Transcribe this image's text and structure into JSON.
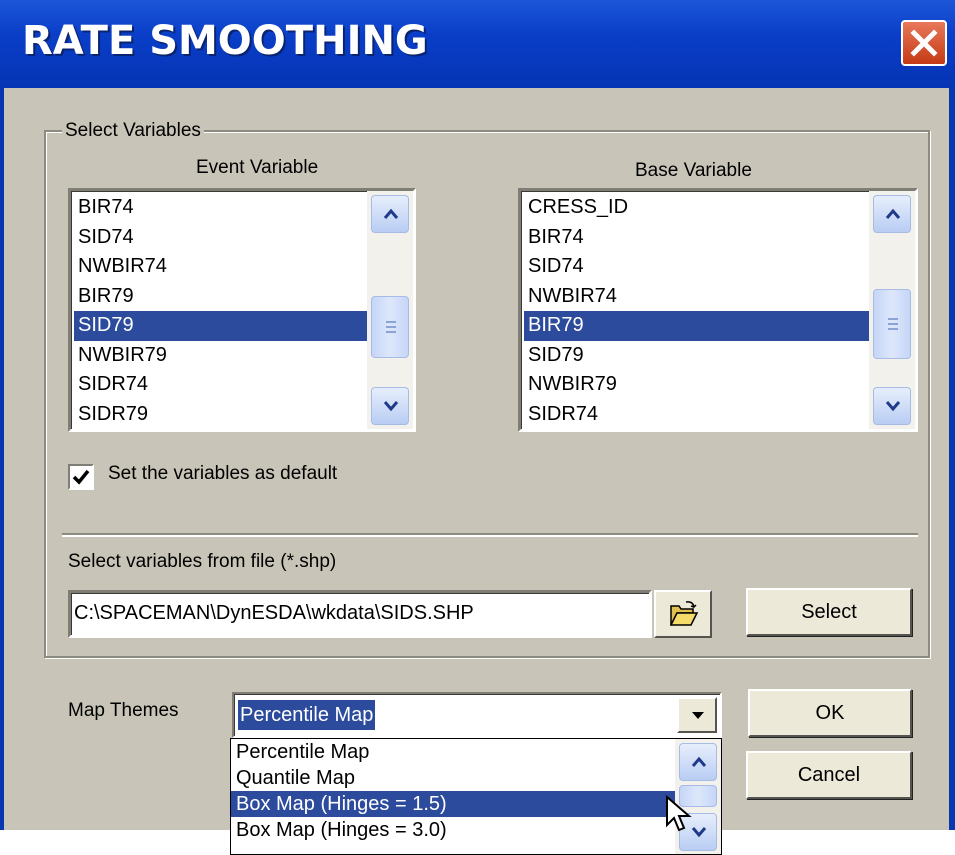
{
  "window": {
    "title": "RATE SMOOTHING"
  },
  "select_variables": {
    "group_label": "Select Variables",
    "event": {
      "label": "Event Variable",
      "items": [
        "BIR74",
        "SID74",
        "NWBIR74",
        "BIR79",
        "SID79",
        "NWBIR79",
        "SIDR74",
        "SIDR79"
      ],
      "selected": "SID79"
    },
    "base": {
      "label": "Base Variable",
      "items": [
        "CRESS_ID",
        "BIR74",
        "SID74",
        "NWBIR74",
        "BIR79",
        "SID79",
        "NWBIR79",
        "SIDR74"
      ],
      "selected": "BIR79"
    },
    "default_checkbox": {
      "label": "Set the variables as default",
      "checked": true
    },
    "file_label": "Select variables  from file (*.shp)",
    "file_path": "C:\\SPACEMAN\\DynESDA\\wkdata\\SIDS.SHP",
    "select_button": "Select"
  },
  "map_themes": {
    "label": "Map Themes",
    "value": "Percentile Map",
    "options": [
      "Percentile Map",
      "Quantile Map",
      "Box Map (Hinges = 1.5)",
      "Box Map (Hinges = 3.0)"
    ],
    "highlighted": "Box Map (Hinges = 1.5)"
  },
  "buttons": {
    "ok": "OK",
    "cancel": "Cancel"
  },
  "colors": {
    "title_bar": "#0a3ec8",
    "selection": "#2c4b9c",
    "dialog_bg": "#c8c5b8"
  },
  "icons": [
    "close-icon",
    "scroll-up-icon",
    "scroll-down-icon",
    "checkmark-icon",
    "folder-open-icon",
    "dropdown-arrow-icon",
    "mouse-cursor-icon"
  ]
}
